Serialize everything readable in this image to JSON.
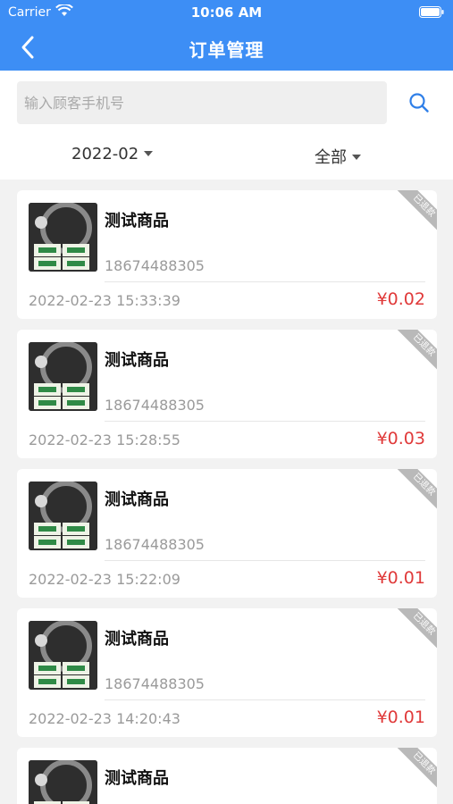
{
  "status_bar": {
    "carrier": "Carrier",
    "time": "10:06 AM"
  },
  "header": {
    "title": "订单管理"
  },
  "search": {
    "placeholder": "输入顾客手机号"
  },
  "filters": {
    "month": "2022-02",
    "status": "全部"
  },
  "orders": [
    {
      "name": "测试商品",
      "phone": "18674488305",
      "time": "2022-02-23 15:33:39",
      "price": "¥0.02",
      "status": "已退款"
    },
    {
      "name": "测试商品",
      "phone": "18674488305",
      "time": "2022-02-23 15:28:55",
      "price": "¥0.03",
      "status": "已退款"
    },
    {
      "name": "测试商品",
      "phone": "18674488305",
      "time": "2022-02-23 15:22:09",
      "price": "¥0.01",
      "status": "已退款"
    },
    {
      "name": "测试商品",
      "phone": "18674488305",
      "time": "2022-02-23 14:20:43",
      "price": "¥0.01",
      "status": "已退款"
    },
    {
      "name": "测试商品",
      "phone": "",
      "time": "",
      "price": "",
      "status": "已退款"
    }
  ],
  "colors": {
    "header": "#3d8ef5",
    "price": "#e03a3a",
    "ribbon": "#b9b9b9"
  }
}
